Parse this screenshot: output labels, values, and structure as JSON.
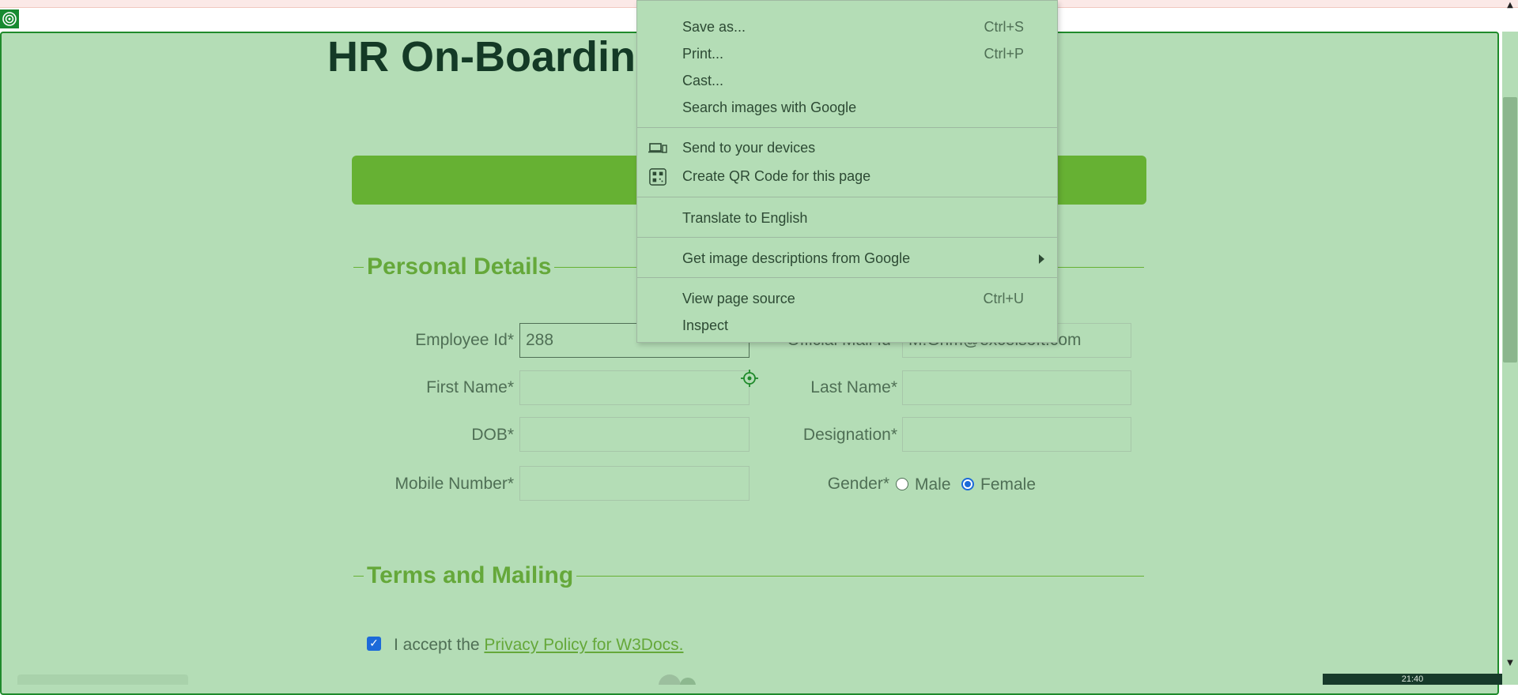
{
  "page": {
    "title": "HR On-Boarding"
  },
  "sections": {
    "personal": "Personal Details",
    "terms": "Terms and Mailing"
  },
  "fields": {
    "employee_id": {
      "label": "Employee Id*",
      "value": "288"
    },
    "official_mail": {
      "label": "Official Mail Id*",
      "value": "M.Grim@excelsoft.com"
    },
    "first_name": {
      "label": "First Name*",
      "value": ""
    },
    "last_name": {
      "label": "Last Name*",
      "value": ""
    },
    "dob": {
      "label": "DOB*",
      "value": ""
    },
    "designation": {
      "label": "Designation*",
      "value": ""
    },
    "mobile": {
      "label": "Mobile Number*",
      "value": ""
    },
    "gender": {
      "label": "Gender*",
      "options": [
        "Male",
        "Female"
      ],
      "selected": "Female"
    }
  },
  "terms": {
    "accept_prefix": "I accept the",
    "privacy_link": "Privacy Policy for W3Docs.",
    "checked": true
  },
  "context_menu": {
    "items": [
      {
        "label": "Save as...",
        "shortcut": "Ctrl+S"
      },
      {
        "label": "Print...",
        "shortcut": "Ctrl+P"
      },
      {
        "label": "Cast...",
        "shortcut": ""
      },
      {
        "label": "Search images with Google",
        "shortcut": ""
      },
      {
        "label": "Send to your devices",
        "shortcut": "",
        "icon": "devices-icon"
      },
      {
        "label": "Create QR Code for this page",
        "shortcut": "",
        "icon": "qr-code-icon"
      },
      {
        "label": "Translate to English",
        "shortcut": ""
      },
      {
        "label": "Get image descriptions from Google",
        "shortcut": "",
        "submenu": true
      },
      {
        "label": "View page source",
        "shortcut": "Ctrl+U"
      },
      {
        "label": "Inspect",
        "shortcut": ""
      }
    ]
  },
  "taskbar": {
    "clock": "21:40"
  },
  "colors": {
    "overlay": "#b4ddb6",
    "accent_green": "#66b133",
    "title_dark": "#143a26",
    "radio_blue": "#1c6ad9"
  }
}
